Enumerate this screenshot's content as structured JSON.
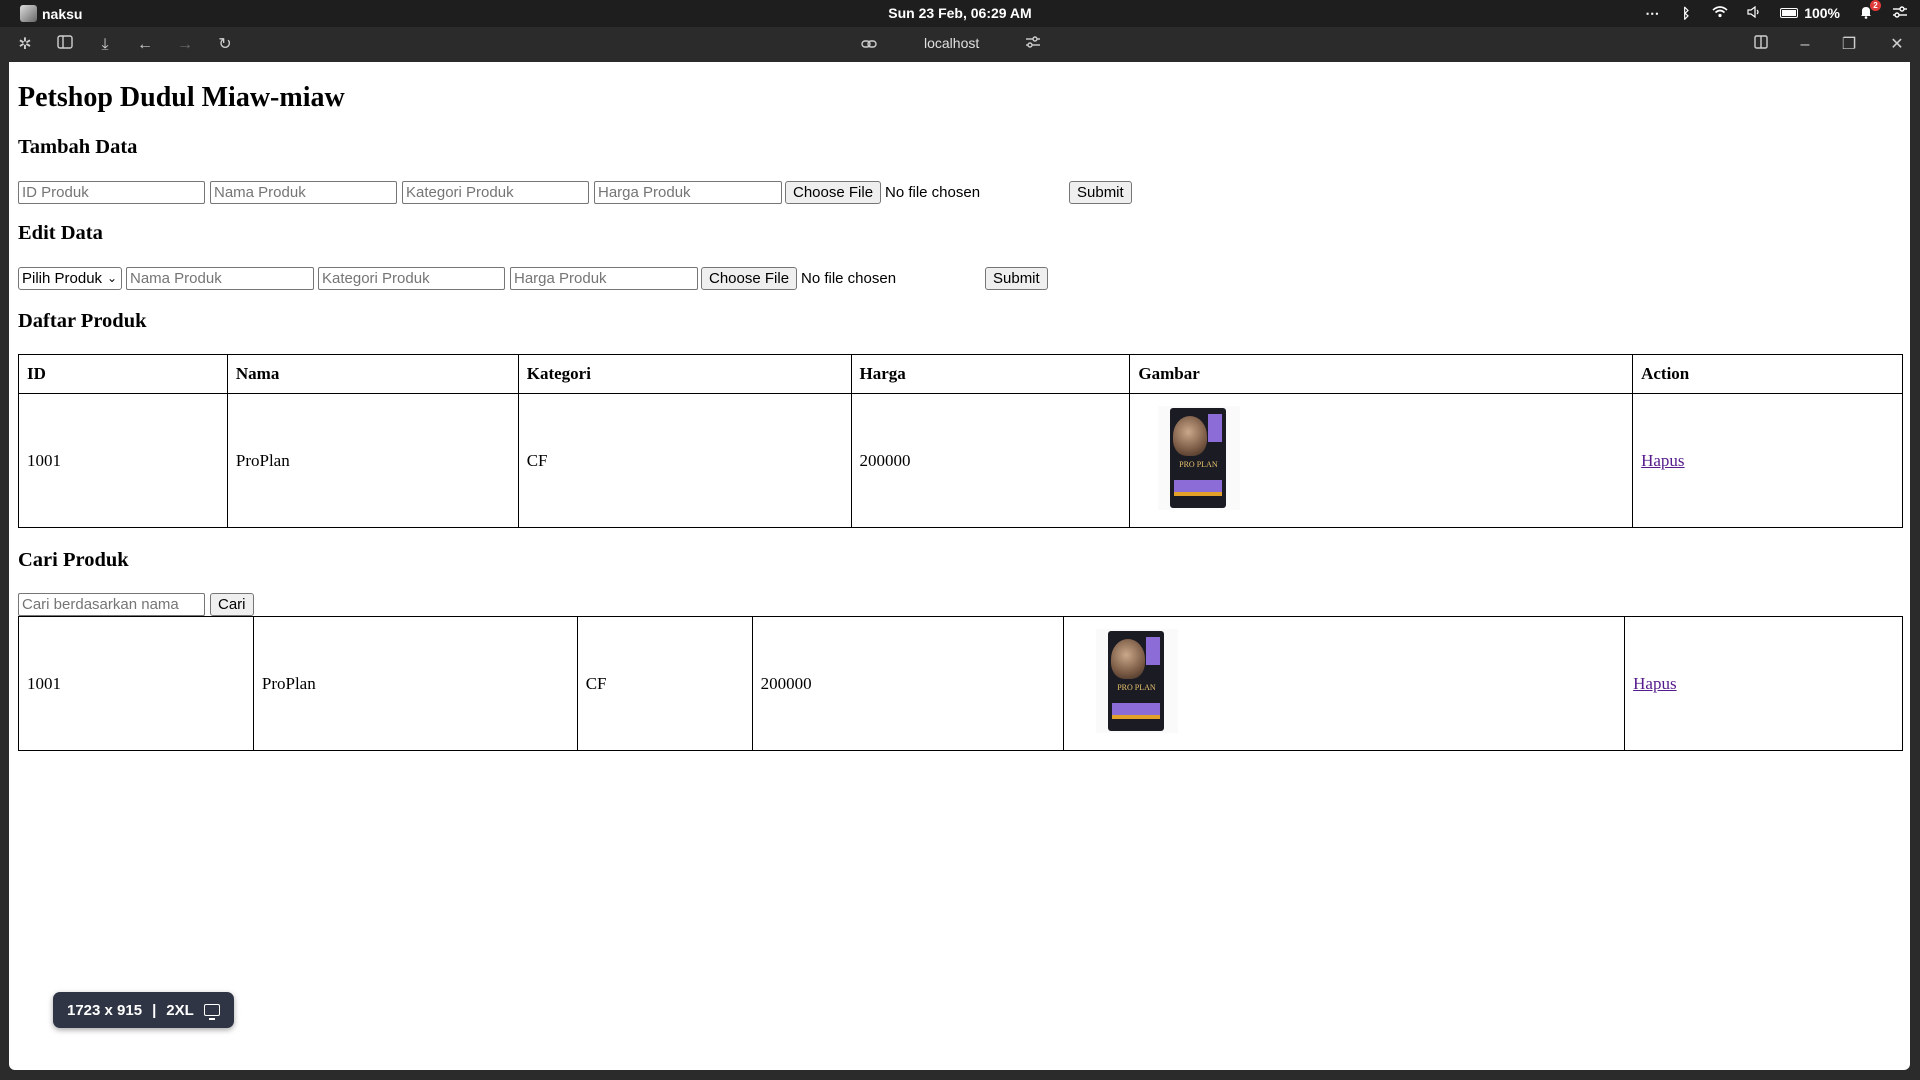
{
  "os": {
    "user": "naksu",
    "clock": "Sun 23 Feb, 06:29 AM",
    "battery": "100%",
    "notifications": "2",
    "icons": [
      "more-icon",
      "bluetooth-icon",
      "wifi-icon",
      "volume-icon",
      "battery-icon",
      "bell-icon",
      "settings-icon"
    ]
  },
  "browser": {
    "url": "localhost"
  },
  "page": {
    "title": "Petshop Dudul Miaw-miaw",
    "tambah": {
      "heading": "Tambah Data",
      "id_placeholder": "ID Produk",
      "nama_placeholder": "Nama Produk",
      "kategori_placeholder": "Kategori Produk",
      "harga_placeholder": "Harga Produk",
      "choose_file": "Choose File",
      "no_file": "No file chosen",
      "submit": "Submit"
    },
    "edit": {
      "heading": "Edit Data",
      "select_value": "Pilih Produk",
      "nama_placeholder": "Nama Produk",
      "kategori_placeholder": "Kategori Produk",
      "harga_placeholder": "Harga Produk",
      "choose_file": "Choose File",
      "no_file": "No file chosen",
      "submit": "Submit"
    },
    "daftar": {
      "heading": "Daftar Produk",
      "columns": [
        "ID",
        "Nama",
        "Kategori",
        "Harga",
        "Gambar",
        "Action"
      ],
      "rows": [
        {
          "id": "1001",
          "nama": "ProPlan",
          "kategori": "CF",
          "harga": "200000",
          "gambar": "proplan-cat-food-bag",
          "action": "Hapus"
        }
      ]
    },
    "cari": {
      "heading": "Cari Produk",
      "placeholder": "Cari berdasarkan nama",
      "button": "Cari",
      "rows": [
        {
          "id": "1001",
          "nama": "ProPlan",
          "kategori": "CF",
          "harga": "200000",
          "gambar": "proplan-cat-food-bag",
          "action": "Hapus"
        }
      ]
    }
  },
  "size_badge": {
    "dimensions": "1723 x 915",
    "separator": "|",
    "breakpoint": "2XL"
  }
}
